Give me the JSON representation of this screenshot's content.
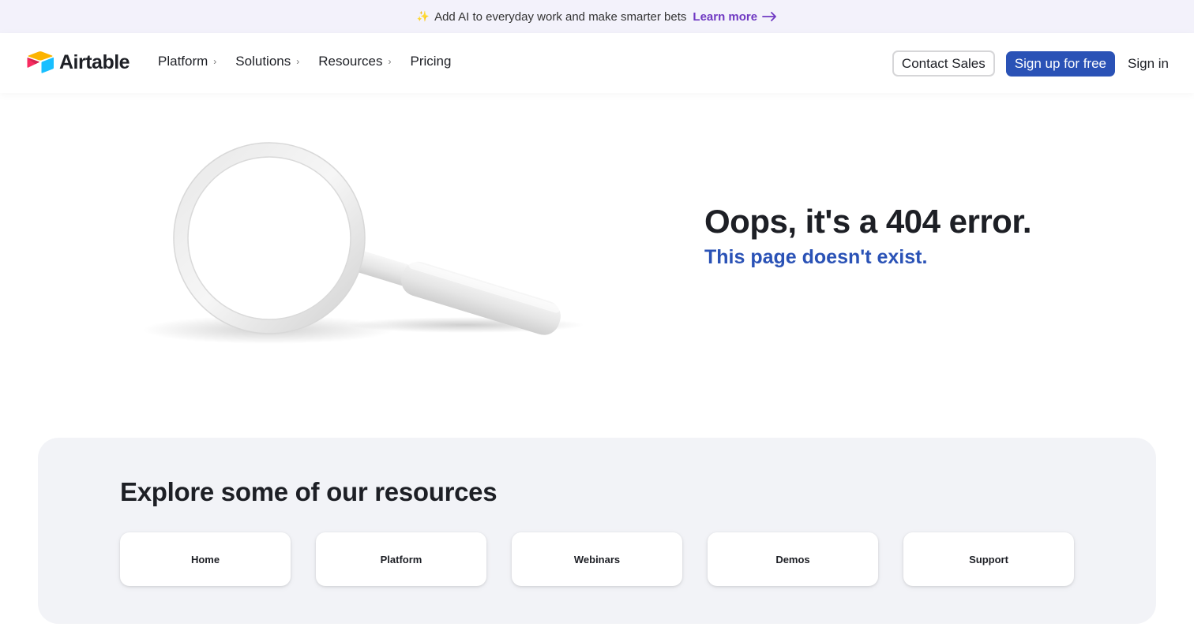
{
  "announcement": {
    "text": "Add AI to everyday work and make smarter bets",
    "link_label": "Learn more",
    "icon": "sparkle-icon"
  },
  "header": {
    "logo_text": "Airtable",
    "nav": [
      {
        "label": "Platform",
        "has_chevron": true
      },
      {
        "label": "Solutions",
        "has_chevron": true
      },
      {
        "label": "Resources",
        "has_chevron": true
      },
      {
        "label": "Pricing",
        "has_chevron": false
      }
    ],
    "contact_sales_label": "Contact Sales",
    "signup_label": "Sign up for free",
    "signin_label": "Sign in"
  },
  "hero": {
    "title": "Oops, it's a 404 error.",
    "subtitle": "This page doesn't exist.",
    "illustration": "magnifying-glass"
  },
  "resources": {
    "title": "Explore some of our resources",
    "cards": [
      {
        "label": "Home"
      },
      {
        "label": "Platform"
      },
      {
        "label": "Webinars"
      },
      {
        "label": "Demos"
      },
      {
        "label": "Support"
      }
    ]
  },
  "colors": {
    "brand_blue": "#2a52b6",
    "announce_bg": "#f3f2fb",
    "link_purple": "#6f39c2",
    "panel_bg": "#f2f3f7",
    "text_dark": "#1d1f25"
  }
}
